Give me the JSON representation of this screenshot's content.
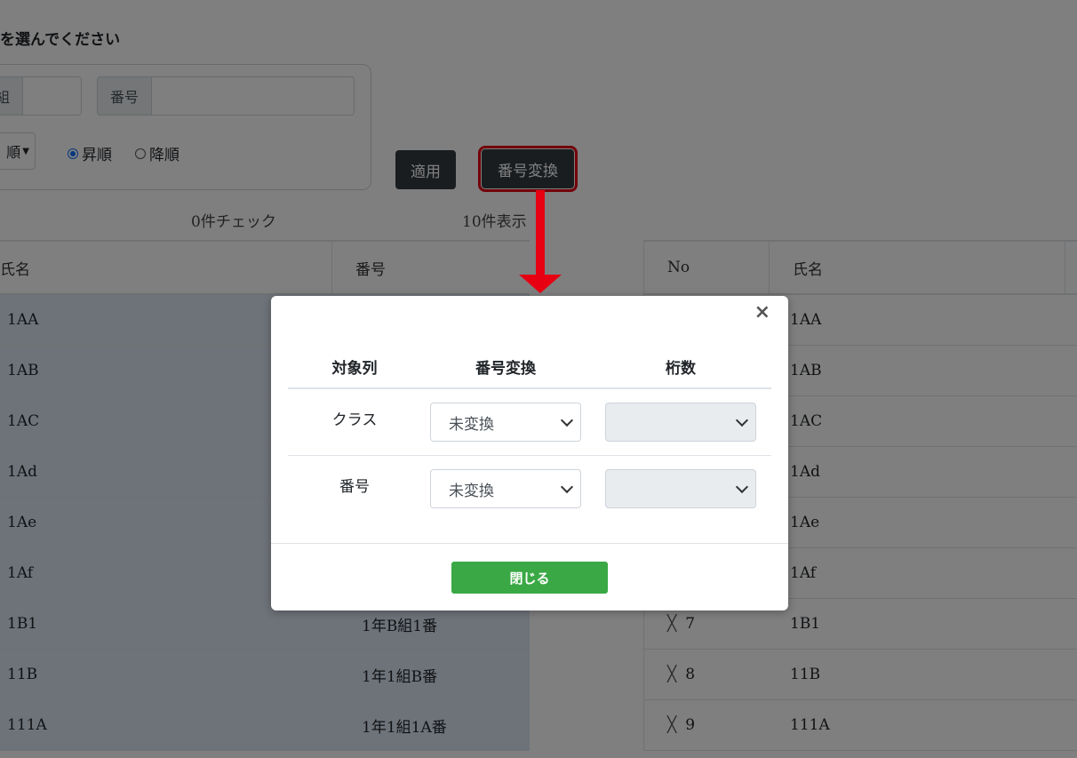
{
  "page": {
    "title": "を選んでください",
    "filters": {
      "group_label_fragment": "組",
      "number_label": "番号",
      "order_select_value": "順",
      "radio_asc": "昇順",
      "radio_desc": "降順"
    },
    "buttons": {
      "apply": "適用",
      "convert": "番号変換"
    },
    "counts": {
      "checked": "0件チェック",
      "shown": "10件表示"
    },
    "left_table": {
      "headers": [
        "氏名",
        "番号"
      ],
      "rows": [
        [
          "1AA",
          ""
        ],
        [
          "1AB",
          ""
        ],
        [
          "1AC",
          ""
        ],
        [
          "1Ad",
          ""
        ],
        [
          "1Ae",
          ""
        ],
        [
          "1Af",
          ""
        ],
        [
          "1B1",
          "1年B組1番"
        ],
        [
          "11B",
          "1年1組B番"
        ],
        [
          "111A",
          "1年1組1A番"
        ]
      ]
    },
    "right_table": {
      "headers": [
        "No",
        "氏名"
      ],
      "rows": [
        [
          "",
          "",
          "1AA"
        ],
        [
          "",
          "",
          "1AB"
        ],
        [
          "",
          "",
          "1AC"
        ],
        [
          "",
          "",
          "1Ad"
        ],
        [
          "",
          "",
          "1Ae"
        ],
        [
          "",
          "",
          "1Af"
        ],
        [
          "╳",
          "7",
          "1B1"
        ],
        [
          "╳",
          "8",
          "11B"
        ],
        [
          "╳",
          "9",
          "111A"
        ]
      ]
    }
  },
  "modal": {
    "close_symbol": "×",
    "headers": [
      "対象列",
      "番号変換",
      "桁数"
    ],
    "rows": [
      {
        "label": "クラス",
        "conversion": "未変換",
        "digits": ""
      },
      {
        "label": "番号",
        "conversion": "未変換",
        "digits": ""
      }
    ],
    "close_button": "閉じる"
  },
  "colors": {
    "highlight": "#e60012",
    "close_button": "#3aa845",
    "dark_button": "#343a40"
  }
}
